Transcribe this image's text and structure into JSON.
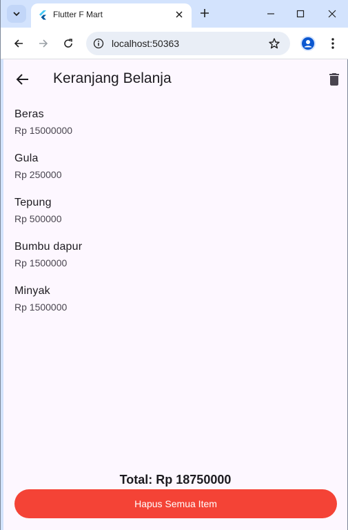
{
  "browser": {
    "tab_title": "Flutter F Mart",
    "url": "localhost:50363",
    "new_tab_symbol": "+",
    "close_tab_symbol": "✕"
  },
  "app": {
    "title": "Keranjang Belanja",
    "items": [
      {
        "name": "Beras",
        "price": "Rp 15000000"
      },
      {
        "name": "Gula",
        "price": "Rp 250000"
      },
      {
        "name": "Tepung",
        "price": "Rp 500000"
      },
      {
        "name": "Bumbu dapur",
        "price": "Rp 1500000"
      },
      {
        "name": "Minyak",
        "price": "Rp 1500000"
      }
    ],
    "total": "Total: Rp 18750000",
    "clear_button": "Hapus Semua Item"
  },
  "colors": {
    "accent_red": "#f44336",
    "app_background": "#fdf7ff",
    "browser_frame": "#d3e3fd"
  },
  "icons": [
    "chevron-down-icon",
    "flutter-icon",
    "close-icon",
    "plus-icon",
    "minimize-icon",
    "maximize-icon",
    "window-close-icon",
    "back-arrow-icon",
    "forward-arrow-icon",
    "reload-icon",
    "info-icon",
    "star-icon",
    "profile-icon",
    "more-vert-icon",
    "arrow-back-icon",
    "delete-icon"
  ]
}
